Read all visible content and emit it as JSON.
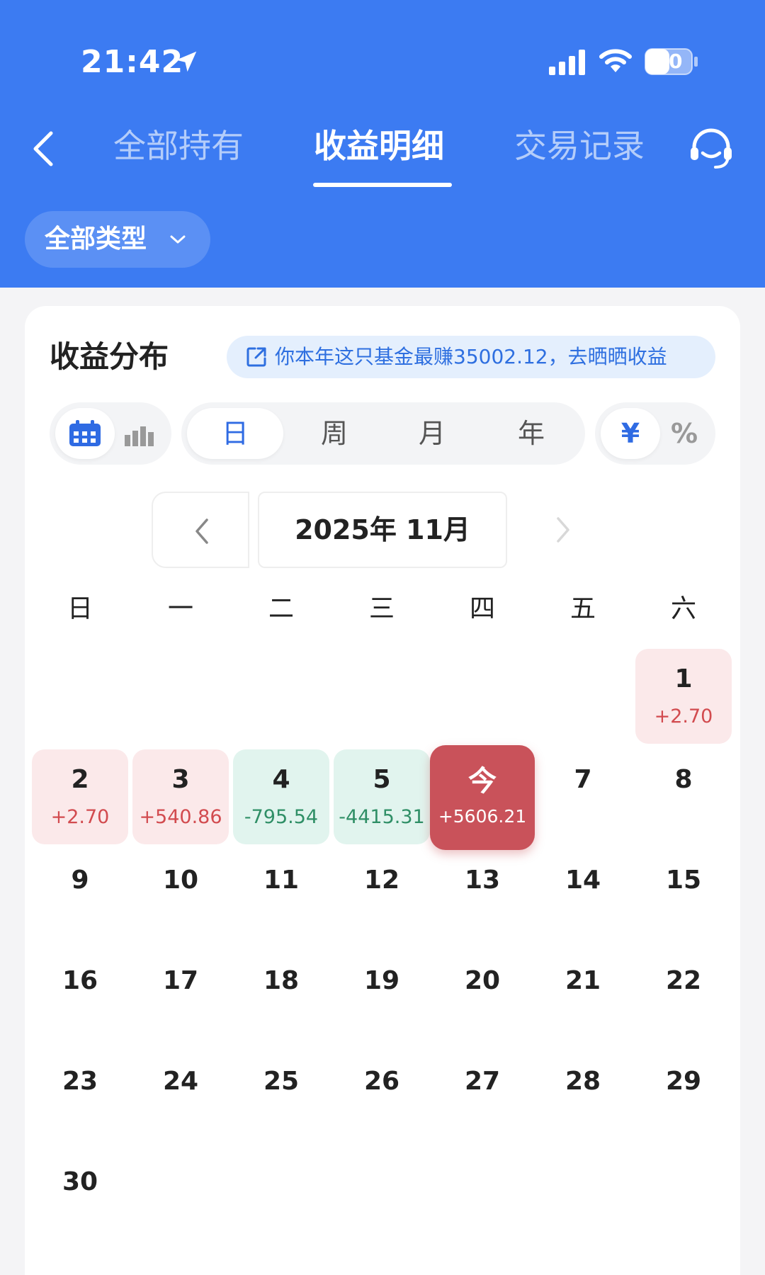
{
  "status_bar": {
    "time": "21:42",
    "battery": "50"
  },
  "nav": {
    "tabs": [
      {
        "label": "全部持有",
        "active": false
      },
      {
        "label": "收益明细",
        "active": true
      },
      {
        "label": "交易记录",
        "active": false
      }
    ]
  },
  "filter": {
    "type_label": "全部类型"
  },
  "card": {
    "title": "收益分布",
    "share_text": "你本年这只基金最赚35002.12，去晒晒收益"
  },
  "view_toggle": {
    "periods": [
      "日",
      "周",
      "月",
      "年"
    ],
    "active_period": "日",
    "units": [
      "¥",
      "%"
    ],
    "active_unit": "¥"
  },
  "calendar": {
    "month_label": "2025年 11月",
    "weekdays": [
      "日",
      "一",
      "二",
      "三",
      "四",
      "五",
      "六"
    ],
    "first_weekday_index": 6,
    "days": [
      {
        "label": "1",
        "value": "+2.70",
        "state": "up"
      },
      {
        "label": "2",
        "value": "+2.70",
        "state": "up"
      },
      {
        "label": "3",
        "value": "+540.86",
        "state": "up"
      },
      {
        "label": "4",
        "value": "-795.54",
        "state": "down"
      },
      {
        "label": "5",
        "value": "-4415.31",
        "state": "down"
      },
      {
        "label": "今",
        "value": "+5606.21",
        "state": "today"
      },
      {
        "label": "7"
      },
      {
        "label": "8"
      },
      {
        "label": "9"
      },
      {
        "label": "10"
      },
      {
        "label": "11"
      },
      {
        "label": "12"
      },
      {
        "label": "13"
      },
      {
        "label": "14"
      },
      {
        "label": "15"
      },
      {
        "label": "16"
      },
      {
        "label": "17"
      },
      {
        "label": "18"
      },
      {
        "label": "19"
      },
      {
        "label": "20"
      },
      {
        "label": "21"
      },
      {
        "label": "22"
      },
      {
        "label": "23"
      },
      {
        "label": "24"
      },
      {
        "label": "25"
      },
      {
        "label": "26"
      },
      {
        "label": "27"
      },
      {
        "label": "28"
      },
      {
        "label": "29"
      },
      {
        "label": "30"
      }
    ]
  },
  "colors": {
    "header_blue": "#3c7bf2",
    "accent_blue": "#2f6be3",
    "gain_red": "#d24b4f",
    "loss_green": "#2f8f66",
    "today_red": "#c9525a"
  }
}
